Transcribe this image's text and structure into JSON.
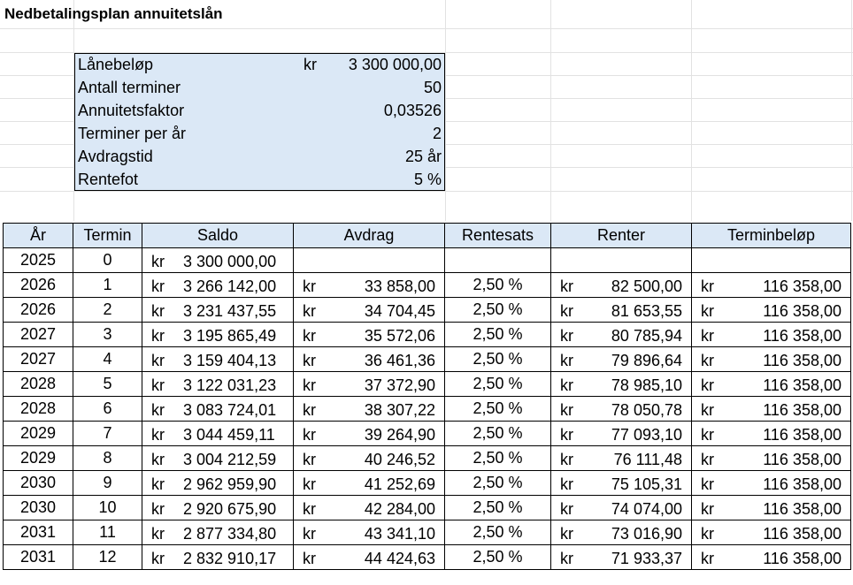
{
  "title": "Nedbetalingsplan annuitetslån",
  "params": [
    {
      "label": "Lånebeløp",
      "kr": "kr",
      "value": "3 300 000,00"
    },
    {
      "label": "Antall terminer",
      "kr": "",
      "value": "50"
    },
    {
      "label": "Annuitetsfaktor",
      "kr": "",
      "value": "0,03526"
    },
    {
      "label": "Terminer per år",
      "kr": "",
      "value": "2"
    },
    {
      "label": "Avdragstid",
      "kr": "",
      "value": "25 år"
    },
    {
      "label": "Rentefot",
      "kr": "",
      "value": "5 %"
    }
  ],
  "currency": "kr",
  "columns": [
    "År",
    "Termin",
    "Saldo",
    "Avdrag",
    "Rentesats",
    "Renter",
    "Terminbeløp"
  ],
  "rows": [
    {
      "ar": "2025",
      "termin": "0",
      "saldo": "3 300 000,00",
      "avdrag": "",
      "rentesats": "",
      "renter": "",
      "terminbelop": ""
    },
    {
      "ar": "2026",
      "termin": "1",
      "saldo": "3 266 142,00",
      "avdrag": "33 858,00",
      "rentesats": "2,50 %",
      "renter": "82 500,00",
      "terminbelop": "116 358,00"
    },
    {
      "ar": "2026",
      "termin": "2",
      "saldo": "3 231 437,55",
      "avdrag": "34 704,45",
      "rentesats": "2,50 %",
      "renter": "81 653,55",
      "terminbelop": "116 358,00"
    },
    {
      "ar": "2027",
      "termin": "3",
      "saldo": "3 195 865,49",
      "avdrag": "35 572,06",
      "rentesats": "2,50 %",
      "renter": "80 785,94",
      "terminbelop": "116 358,00"
    },
    {
      "ar": "2027",
      "termin": "4",
      "saldo": "3 159 404,13",
      "avdrag": "36 461,36",
      "rentesats": "2,50 %",
      "renter": "79 896,64",
      "terminbelop": "116 358,00"
    },
    {
      "ar": "2028",
      "termin": "5",
      "saldo": "3 122 031,23",
      "avdrag": "37 372,90",
      "rentesats": "2,50 %",
      "renter": "78 985,10",
      "terminbelop": "116 358,00"
    },
    {
      "ar": "2028",
      "termin": "6",
      "saldo": "3 083 724,01",
      "avdrag": "38 307,22",
      "rentesats": "2,50 %",
      "renter": "78 050,78",
      "terminbelop": "116 358,00"
    },
    {
      "ar": "2029",
      "termin": "7",
      "saldo": "3 044 459,11",
      "avdrag": "39 264,90",
      "rentesats": "2,50 %",
      "renter": "77 093,10",
      "terminbelop": "116 358,00"
    },
    {
      "ar": "2029",
      "termin": "8",
      "saldo": "3 004 212,59",
      "avdrag": "40 246,52",
      "rentesats": "2,50 %",
      "renter": "76 111,48",
      "terminbelop": "116 358,00"
    },
    {
      "ar": "2030",
      "termin": "9",
      "saldo": "2 962 959,90",
      "avdrag": "41 252,69",
      "rentesats": "2,50 %",
      "renter": "75 105,31",
      "terminbelop": "116 358,00"
    },
    {
      "ar": "2030",
      "termin": "10",
      "saldo": "2 920 675,90",
      "avdrag": "42 284,00",
      "rentesats": "2,50 %",
      "renter": "74 074,00",
      "terminbelop": "116 358,00"
    },
    {
      "ar": "2031",
      "termin": "11",
      "saldo": "2 877 334,80",
      "avdrag": "43 341,10",
      "rentesats": "2,50 %",
      "renter": "73 016,90",
      "terminbelop": "116 358,00"
    },
    {
      "ar": "2031",
      "termin": "12",
      "saldo": "2 832 910,17",
      "avdrag": "44 424,63",
      "rentesats": "2,50 %",
      "renter": "71 933,37",
      "terminbelop": "116 358,00"
    }
  ]
}
